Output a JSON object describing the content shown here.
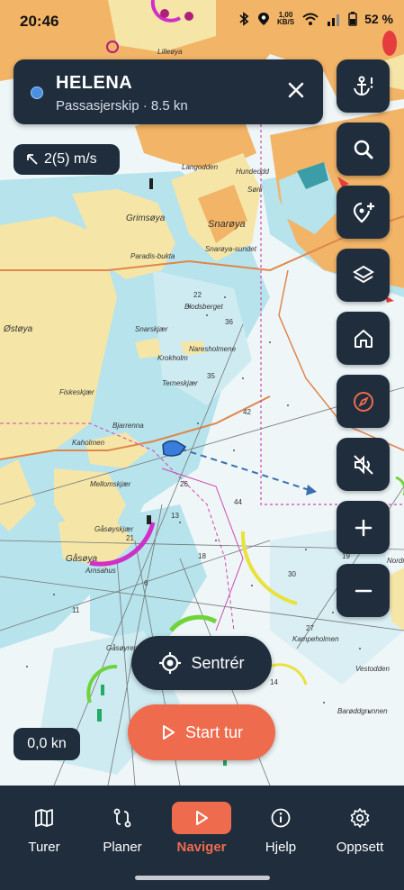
{
  "status_bar": {
    "time": "20:46",
    "net_speed_value": "1,00",
    "net_speed_unit": "KB/S",
    "battery": "52 %",
    "icons": [
      "bluetooth-icon",
      "location-icon",
      "wifi-icon",
      "signal-icon",
      "battery-icon"
    ]
  },
  "vessel": {
    "name": "HELENA",
    "subtitle": "Passasjerskip · 8.5 kn"
  },
  "wind": {
    "value": "2(5) m/s"
  },
  "map_labels": {
    "lillesoy": "Lilleøya",
    "langodden": "Langodden",
    "hundeodd": "Hundeodd",
    "sorli": "Sørli",
    "snaroya": "Snarøya",
    "snaroyasundet": "Snarøya-sundet",
    "grimsoya": "Grimsøya",
    "ostoya": "Østøya",
    "paradisbukta": "Paradis-bukta",
    "blodsberget": "Blodsberget",
    "snarskjaer": "Snarskjær",
    "krokholm": "Krokholm",
    "naresholmene": "Naresholmene",
    "fiskeskjaer": "Fiskeskjær",
    "terneskjaer": "Terneskjær",
    "bjarrenna": "Bjarrenna",
    "kaholmen": "Kaholmen",
    "mellomskjaer": "Mellomskjær",
    "gasoyskjaer": "Gåsøyskjær",
    "gasoya": "Gåsøya",
    "arnsahus": "Arnsahus",
    "gasoyrenna": "Gåsøyrenna",
    "kampeholm": "Kampeholmen",
    "vestodden": "Vestodden",
    "baroddgrunnen": "Barøddgrunnen",
    "nordre": "Nordre"
  },
  "side_buttons": [
    {
      "name": "anchor-alarm-button",
      "icon": "anchor-alert-icon"
    },
    {
      "name": "search-button",
      "icon": "search-icon"
    },
    {
      "name": "add-waypoint-button",
      "icon": "location-add-icon"
    },
    {
      "name": "layers-button",
      "icon": "layers-icon"
    },
    {
      "name": "home-button",
      "icon": "home-icon"
    },
    {
      "name": "compass-button",
      "icon": "compass-icon",
      "accent": "#ef6b4d"
    },
    {
      "name": "mute-button",
      "icon": "volume-off-icon"
    },
    {
      "name": "zoom-in-button",
      "icon": "plus-icon"
    },
    {
      "name": "zoom-out-button",
      "icon": "minus-icon"
    }
  ],
  "actions": {
    "center_label": "Sentrér",
    "start_label": "Start tur"
  },
  "speed": "0,0 kn",
  "nav": {
    "items": [
      {
        "label": "Turer",
        "icon": "map-icon"
      },
      {
        "label": "Planer",
        "icon": "route-icon"
      },
      {
        "label": "Naviger",
        "icon": "play-icon",
        "active": true
      },
      {
        "label": "Hjelp",
        "icon": "info-icon"
      },
      {
        "label": "Oppsett",
        "icon": "gear-icon"
      }
    ]
  },
  "colors": {
    "panel": "#1f2d3d",
    "accent": "#ef6b4d",
    "land": "#f5e6a8",
    "urban": "#f2b467",
    "shallow": "#b6e3ec",
    "sea": "#eef6f8"
  }
}
